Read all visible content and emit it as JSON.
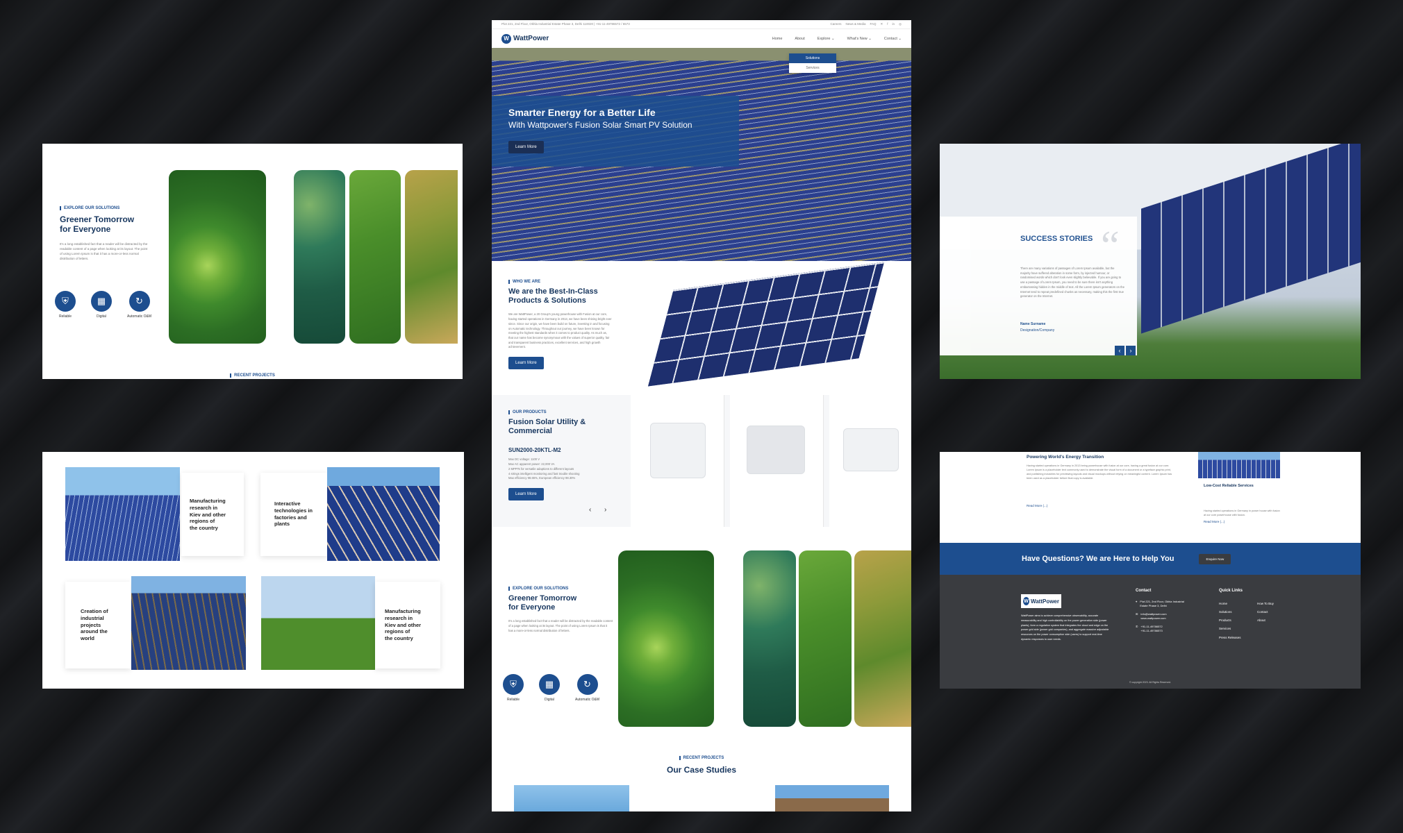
{
  "header": {
    "address": "Plot 221, 2nd Floor, Okhla Industrial Estate Phase 3, Delhi 110020 | +91-11-49786572 / 6573",
    "top_links": [
      "Careers",
      "News & Media",
      "FAQ"
    ],
    "logo_text": "WattPower",
    "nav": [
      "Home",
      "About",
      "Explore ⌄",
      "What's New ⌄",
      "Contact ⌄"
    ],
    "dropdown": [
      "Solutions",
      "Services"
    ]
  },
  "hero": {
    "title": "Smarter Energy for a Better Life",
    "subtitle": "With Wattpower's Fusion Solar Smart PV Solution",
    "button": "Learn More"
  },
  "who": {
    "eyebrow": "WHO WE ARE",
    "title_line1": "We are the Best-In-Class",
    "title_line2": "Products & Solutions",
    "body": "We are WattPower, a 20 Group's young powerhouse with Fusion at our core, having started operations in Germany in 2013, we have been shining bright ever since. Since our origin, we have been build on future, investing in and focusing on Automatic technology. Throughout our journey, we have been known for meeting the highest standards when it comes to product quality. As much as, that our name has become synonymous with the values of superior quality, fair and transparent business practices, excellent services, and high growth achievement.",
    "button": "Learn More"
  },
  "products": {
    "eyebrow": "OUR PRODUCTS",
    "title_line1": "Fusion Solar Utility &",
    "title_line2": "Commercial",
    "model": "SUN2000-20KTL-M2",
    "specs": [
      "Max DC voltage: 1100 V",
      "Max AC apparent power: 22,000 VA",
      "2 MPPTs for versatile adaptions to different layouts",
      "4 strings intelligent monitoring and fast trouble shooting",
      "Max efficiency 98.65%, European efficiency 98.30%"
    ],
    "button": "Learn More"
  },
  "greener": {
    "eyebrow": "EXPLORE OUR SOLUTIONS",
    "title_line1": "Greener Tomorrow",
    "title_line2": "for Everyone",
    "body": "It's a long established fact that a reader will be distracted by the readable content of a page when looking at its layout. The point of using Lorem Ipsum is that it has a more-or-less normal distribution of letters.",
    "features": [
      "Reliable",
      "Digital",
      "Automatic O&M"
    ]
  },
  "cases": {
    "eyebrow": "RECENT PROJECTS",
    "title": "Our Case Studies",
    "items": [
      [
        "Manufacturing",
        "research in",
        "Kiev and other",
        "regions of",
        "the country"
      ],
      [
        "Interactive",
        "technologies in",
        "factories and",
        "plants"
      ],
      [
        "Creation of",
        "industrial",
        "projects",
        "around the",
        "world"
      ],
      [
        "Manufacturing",
        "research in",
        "Kiev and other",
        "regions of",
        "the country"
      ]
    ]
  },
  "success": {
    "title": "SUCCESS STORIES",
    "quote_mark": "“",
    "body": "There are many variations of passages of Lorem Ipsum available, but the majority have suffered alteration in some form, by injected humour, or randomised words which don't look even slightly believable. If you are going to use a passage of Lorem Ipsum, you need to be sure there isn't anything embarrassing hidden in the middle of text. All the Lorem Ipsum generators on the Internet tend to repeat predefined chunks as necessary, making this the first true generator on the Internet.",
    "name": "Name Surname",
    "designation": "Designation/Company",
    "prev": "‹",
    "next": "›"
  },
  "footer_panel": {
    "powering_title": "Powering World's Energy Transition",
    "powering_body": "Having started operations in Germany in 2013 being powerhouse with fusion at our core, having a great fusion at our core. Lorem Ipsum is a placeholder text commonly used to demonstrate the visual form of a document or a typeface graphic print, and publishing industries for previewing layouts and visual mockups without relying on meaningful content. Lorem Ipsum has been used as a placeholder before final copy is available.",
    "read_more": "Read More (...)",
    "service_title": "Low-Cost Reliable Services",
    "service_body": "Having started operations in Germany in power house with fusion at our core powerhouse with fusion.",
    "service_read_more": "Read More (...)",
    "cta": "Have Questions? We are Here to Help You",
    "cta_button": "Enquire Now",
    "about": "WattPower aims to achieve comprehensive observability, accurate measurability and high controllability on the power generation side (power plants), form a regulation system that integrates the cloud and edge on the power grid side (power grid companies), and aggregate massive adjustable resources on the power consumption side (users) to support real-time dynamic responses to user needs.",
    "contact_title": "Contact",
    "contact_address": "Plot 221, 2nd Floor, Okhla Industrial Estate Phase 3, Delhi",
    "contact_email": "info@wattpower.com",
    "contact_web": "www.wattpower.com",
    "contact_phone1": "+91-11-49786572",
    "contact_phone2": "+91-11-49786573",
    "quick_title": "Quick Links",
    "quick_col1": [
      "Home",
      "Solutions",
      "Products",
      "Services",
      "Press Releases"
    ],
    "quick_col2": [
      "How To Buy",
      "Contact",
      "About"
    ],
    "copyright": "© copyright 2023. All Rights Reserved."
  },
  "colors": {
    "brand": "#1d4e8f",
    "navy": "#17365e",
    "footer": "#3a3c40"
  }
}
